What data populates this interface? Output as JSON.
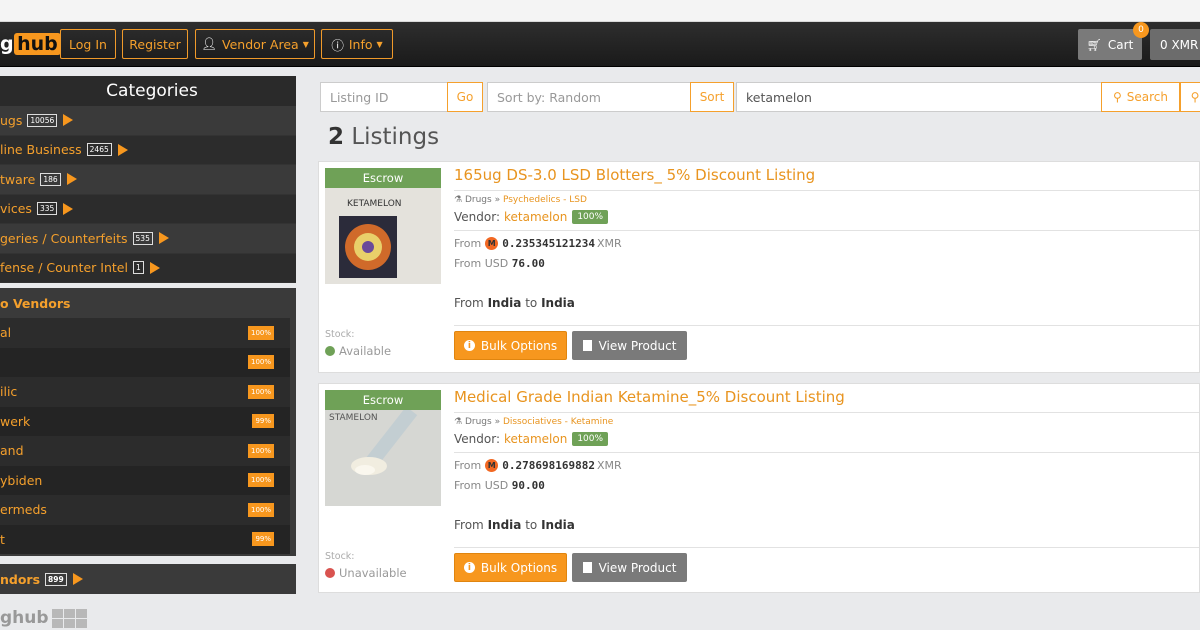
{
  "navbar": {
    "logo_left": "g",
    "logo_right": "hub",
    "login": "Log In",
    "register": "Register",
    "vendor_area": "Vendor Area",
    "info": "Info",
    "cart": "Cart",
    "cart_count": "0",
    "xmr": "0 XMR"
  },
  "categories": {
    "title": "Categories",
    "items": [
      {
        "label": "ugs",
        "count": "10056"
      },
      {
        "label": "line Business",
        "count": "2465"
      },
      {
        "label": "tware",
        "count": "186"
      },
      {
        "label": "vices",
        "count": "335"
      },
      {
        "label": "geries / Counterfeits",
        "count": "535"
      },
      {
        "label": "fense / Counter Intel",
        "count": "1"
      }
    ]
  },
  "top_vendors": {
    "title": "o Vendors",
    "items": [
      {
        "label": "al",
        "score": "100%"
      },
      {
        "label": "",
        "score": "100%"
      },
      {
        "label": "ilic",
        "score": "100%"
      },
      {
        "label": "werk",
        "score": "99%"
      },
      {
        "label": "and",
        "score": "100%"
      },
      {
        "label": "ybiden",
        "score": "100%"
      },
      {
        "label": "ermeds",
        "score": "100%"
      },
      {
        "label": "t",
        "score": "99%"
      }
    ]
  },
  "all_vendors": {
    "label": "ndors",
    "count": "899"
  },
  "footer": {
    "logo_left": "g",
    "logo_right": "hub"
  },
  "search": {
    "listing_id_placeholder": "Listing ID",
    "go": "Go",
    "sort_placeholder": "Sort by: Random",
    "sort": "Sort",
    "query": "ketamelon",
    "search": "Search"
  },
  "results": {
    "count": "2",
    "label": "Listings"
  },
  "listings": [
    {
      "escrow": "Escrow",
      "thumb_text": "KETAMELON",
      "title": "165ug DS-3.0 LSD Blotters_ 5% Discount Listing",
      "crumb_root": "Drugs",
      "crumb_cat": "Psychedelics - LSD",
      "vendor_label": "Vendor:",
      "vendor": "ketamelon",
      "vendor_score": "100%",
      "from_label": "From",
      "xmr_value": "0.235345121234",
      "xmr_unit": "XMR",
      "usd_label": "From USD",
      "usd_value": "76.00",
      "ship_from_label": "From",
      "ship_from": "India",
      "ship_to_label": "to",
      "ship_to": "India",
      "stock_label": "Stock:",
      "stock": "Available",
      "stock_color": "#6fa157",
      "bulk": "Bulk Options",
      "view": "View Product"
    },
    {
      "escrow": "Escrow",
      "thumb_text": "STAMELON",
      "title": "Medical Grade Indian Ketamine_5% Discount Listing",
      "crumb_root": "Drugs",
      "crumb_cat": "Dissociatives - Ketamine",
      "vendor_label": "Vendor:",
      "vendor": "ketamelon",
      "vendor_score": "100%",
      "from_label": "From",
      "xmr_value": "0.278698169882",
      "xmr_unit": "XMR",
      "usd_label": "From USD",
      "usd_value": "90.00",
      "ship_from_label": "From",
      "ship_from": "India",
      "ship_to_label": "to",
      "ship_to": "India",
      "stock_label": "Stock:",
      "stock": "Unavailable",
      "stock_color": "#d9534f",
      "bulk": "Bulk Options",
      "view": "View Product"
    }
  ]
}
